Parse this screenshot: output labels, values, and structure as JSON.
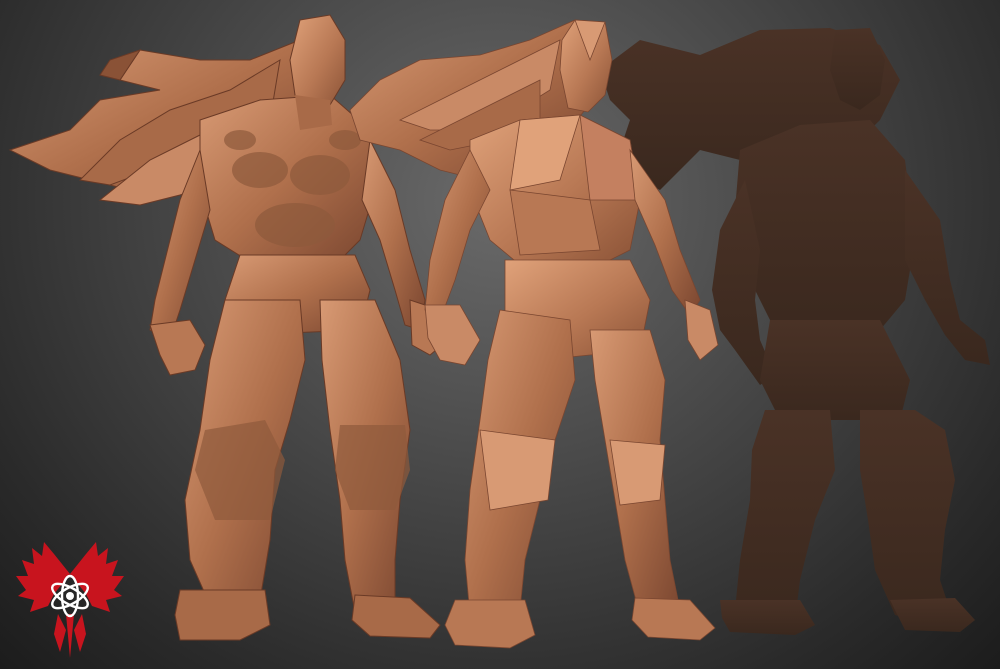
{
  "scene": {
    "description_colors": {
      "background_top": "#6a6a6a",
      "background_bottom": "#1c1c1c",
      "clay_light": "#c98a66",
      "clay_mid": "#a86a48",
      "clay_dark": "#7a4630",
      "silhouette": "#3d2a20",
      "logo_red": "#c8141e",
      "logo_white": "#ffffff"
    }
  },
  "figures": [
    {
      "name": "high-poly-sculpt"
    },
    {
      "name": "low-poly-model"
    },
    {
      "name": "silhouette"
    }
  ],
  "logo": {
    "icon": "winged-atom-emblem-icon"
  }
}
